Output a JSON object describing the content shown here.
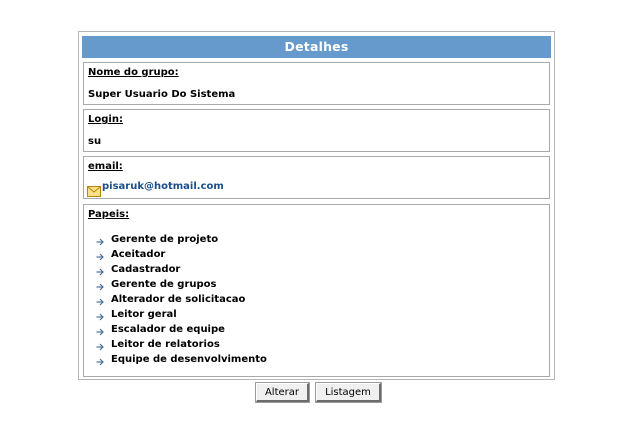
{
  "header": {
    "title": "Detalhes"
  },
  "group": {
    "label": "Nome do grupo:",
    "value": "Super Usuario Do Sistema"
  },
  "login": {
    "label": "Login:",
    "value": "su"
  },
  "email": {
    "label": "email:",
    "value": "pisaruk@hotmail.com",
    "icon": "envelope-icon",
    "link_color": "#1a4f8a"
  },
  "roles": {
    "label": "Papeis:",
    "icon": "arrow-right-icon",
    "items": [
      "Gerente de projeto",
      "Aceitador",
      "Cadastrador",
      "Gerente de grupos",
      "Alterador de solicitacao",
      "Leitor geral",
      "Escalador de equipe",
      "Leitor de relatorios",
      "Equipe de desenvolvimento"
    ]
  },
  "buttons": {
    "alterar": "Alterar",
    "listagem": "Listagem"
  },
  "colors": {
    "header_bg": "#6699cc",
    "header_text": "#ffffff",
    "border": "#a9a9a9"
  }
}
